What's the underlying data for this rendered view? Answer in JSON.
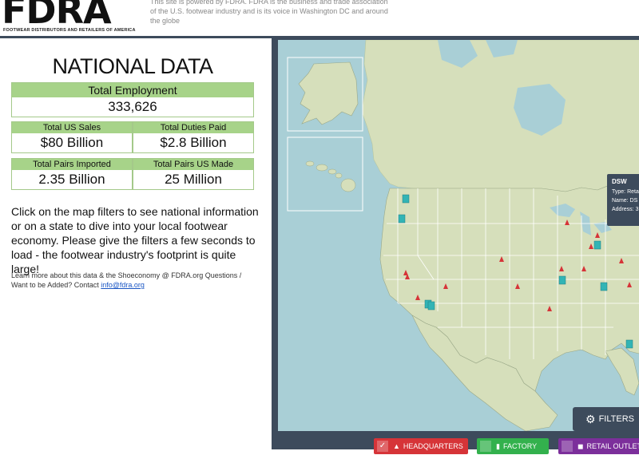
{
  "header": {
    "logo_text": "FDRA",
    "logo_tagline": "FOOTWEAR DISTRIBUTORS AND RETAILERS OF AMERICA",
    "description": "This site is powered by FDRA. FDRA is the business and trade association of the U.S. footwear industry and is its voice in Washington DC and around the globe"
  },
  "national": {
    "title": "NATIONAL DATA",
    "employment_label": "Total Employment",
    "employment_value": "333,626",
    "sales_label": "Total US Sales",
    "sales_value": "$80 Billion",
    "duties_label": "Total Duties Paid",
    "duties_value": "$2.8 Billion",
    "imported_label": "Total Pairs Imported",
    "imported_value": "2.35 Billion",
    "made_label": "Total Pairs US Made",
    "made_value": "25 Million"
  },
  "instructions": "Click on the map filters to see national information or on a state to dive into your local footwear economy. Please give the filters a few seconds to load - the footwear industry's footprint is quite large!",
  "learn_more": {
    "text": "Learn more about this data & the Shoeconomy @ FDRA.org Questions / Want to be Added? Contact",
    "email": "info@fdra.org"
  },
  "tooltip": {
    "title": "DSW",
    "type": "Type: Reta",
    "name": "Name: DS",
    "address": "Address: 3"
  },
  "filters": {
    "label": "FILTERS",
    "icon": "gear-icon"
  },
  "legend": {
    "headquarters": "HEADQUARTERS",
    "factory": "FACTORY",
    "retail": "RETAIL OUTLET"
  },
  "colors": {
    "green_label": "#a7d389",
    "navy": "#3d4b5c",
    "ocean": "#a9cfd6",
    "land": "#d6dfbb",
    "hq_red": "#d63438",
    "factory_green": "#33b14d",
    "retail_purple": "#7c2f9b",
    "marker_teal": "#32b4b5"
  }
}
